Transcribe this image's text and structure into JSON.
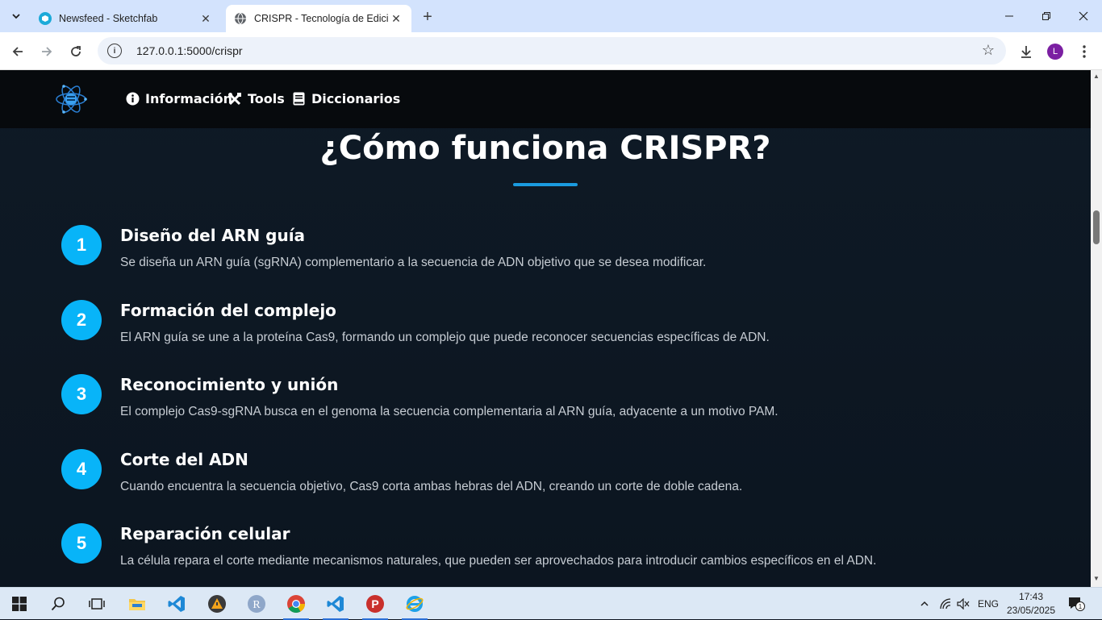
{
  "browser": {
    "tabs": [
      {
        "title": "Newsfeed - Sketchfab",
        "active": false
      },
      {
        "title": "CRISPR - Tecnología de Edición",
        "active": true
      }
    ],
    "url": "127.0.0.1:5000/crispr",
    "profile_initial": "L"
  },
  "site": {
    "nav": [
      {
        "label": "Información",
        "icon": "info-circle-icon"
      },
      {
        "label": "Tools",
        "icon": "tools-icon"
      },
      {
        "label": "Diccionarios",
        "icon": "book-icon"
      }
    ],
    "heading": "¿Cómo funciona CRISPR?",
    "accent_color": "#08b4f8",
    "steps": [
      {
        "number": "1",
        "title": "Diseño del ARN guía",
        "description": "Se diseña un ARN guía (sgRNA) complementario a la secuencia de ADN objetivo que se desea modificar."
      },
      {
        "number": "2",
        "title": "Formación del complejo",
        "description": "El ARN guía se une a la proteína Cas9, formando un complejo que puede reconocer secuencias específicas de ADN."
      },
      {
        "number": "3",
        "title": "Reconocimiento y unión",
        "description": "El complejo Cas9-sgRNA busca en el genoma la secuencia complementaria al ARN guía, adyacente a un motivo PAM."
      },
      {
        "number": "4",
        "title": "Corte del ADN",
        "description": "Cuando encuentra la secuencia objetivo, Cas9 corta ambas hebras del ADN, creando un corte de doble cadena."
      },
      {
        "number": "5",
        "title": "Reparación celular",
        "description": "La célula repara el corte mediante mecanismos naturales, que pueden ser aprovechados para introducir cambios específicos en el ADN."
      }
    ]
  },
  "taskbar": {
    "language": "ENG",
    "time": "17:43",
    "date": "23/05/2025",
    "notification_count": "1"
  }
}
